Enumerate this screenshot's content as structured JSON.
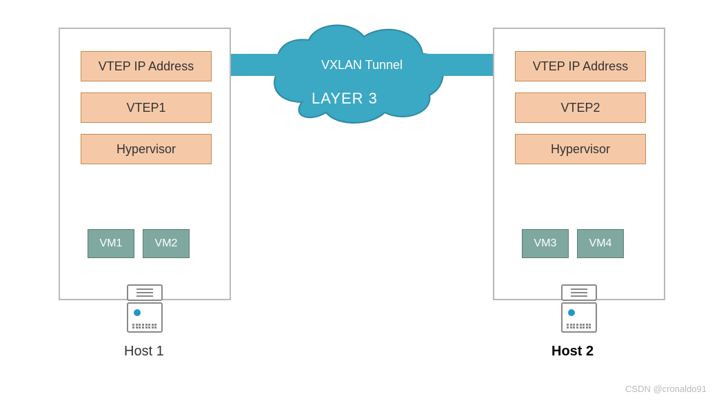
{
  "hosts": [
    {
      "vtep_ip_label": "VTEP IP Address",
      "vtep_label": "VTEP1",
      "hypervisor_label": "Hypervisor",
      "vm_a": "VM1",
      "vm_b": "VM2",
      "host_label": "Host 1"
    },
    {
      "vtep_ip_label": "VTEP IP Address",
      "vtep_label": "VTEP2",
      "hypervisor_label": "Hypervisor",
      "vm_a": "VM3",
      "vm_b": "VM4",
      "host_label": "Host  2"
    }
  ],
  "tunnel": {
    "label": "VXLAN Tunnel",
    "layer": "LAYER 3"
  },
  "watermark": "CSDN @cronaldo91"
}
